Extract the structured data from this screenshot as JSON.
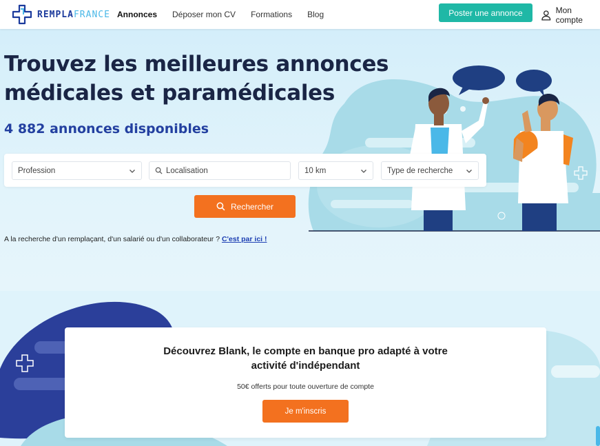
{
  "header": {
    "logo": {
      "part1": "REMPLA",
      "part2": "FRANCE",
      "icon": "medical-cross-icon"
    },
    "nav": [
      {
        "label": "Annonces",
        "active": true
      },
      {
        "label": "Déposer mon CV",
        "active": false
      },
      {
        "label": "Formations",
        "active": false
      },
      {
        "label": "Blog",
        "active": false
      }
    ],
    "post_button": "Poster une annonce",
    "account_label": "Mon compte",
    "account_icon": "user-icon"
  },
  "hero": {
    "title_line1": "Trouvez les meilleures annonces",
    "title_line2": "médicales et paramédicales",
    "count_text": "4 882 annonces disponibles",
    "illustration": "doctor-and-patient-illustration"
  },
  "search": {
    "profession": "Profession",
    "location_placeholder": "Localisation",
    "radius": "10 km",
    "search_type": "Type de recherche",
    "button": "Rechercher",
    "button_icon": "search-icon"
  },
  "recruit": {
    "text": "A la recherche d'un remplaçant, d'un salarié ou d'un collaborateur ? ",
    "link": "C'est par ici !"
  },
  "promo": {
    "title_line1": "Découvrez Blank, le compte en banque pro adapté à votre",
    "title_line2": "activité d'indépendant",
    "subtitle": "50€ offerts pour toute ouverture de compte",
    "button": "Je m'inscris"
  },
  "colors": {
    "brand_blue": "#1b3a9c",
    "teal": "#1fb8a6",
    "orange": "#f3711f",
    "title_dark": "#1a2545",
    "count_blue": "#2340a0"
  }
}
